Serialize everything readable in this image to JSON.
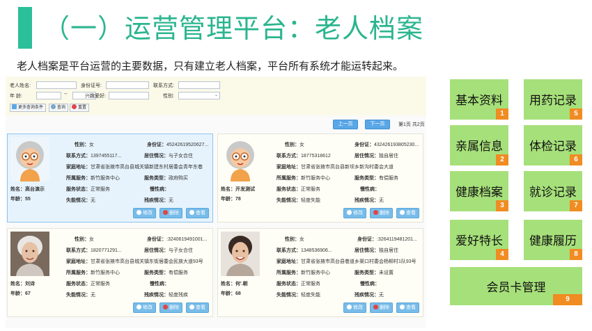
{
  "header": {
    "title": "（一）运营管理平台：老人档案",
    "subtitle": "老人档案是平台运营的主要数据，只有建立老人档案，平台所有系统才能运转起来。"
  },
  "search": {
    "name_label": "老人姓名:",
    "id_label": "身份证号:",
    "contact_label": "联系方式:",
    "age_label": "年 龄:",
    "age_dash": "--",
    "hobby_label": "兴趣爱好:",
    "gender_label": "性别:",
    "more_button": "更多查询条件",
    "query_button": "查询",
    "reset_button": "重置"
  },
  "pager": {
    "prev": "上一页",
    "next": "下一页",
    "info": "第1页 共2页"
  },
  "card_labels": {
    "gender": "性别：",
    "id": "身份证：",
    "contact": "联系方式：",
    "living": "居住情况：",
    "address": "家庭地址：",
    "agency": "所属服务：",
    "service_type": "服务类型：",
    "status": "服务状态：",
    "chronic": "慢性病：",
    "disability": "失能情况：",
    "handicap": "残疾情况：",
    "name": "姓名：",
    "age": "年龄："
  },
  "card_buttons": {
    "edit": "修改",
    "delete": "删除",
    "view": "查看"
  },
  "cards": [
    {
      "name": "高台演示",
      "age": "55",
      "gender": "女",
      "id": "45242619520627...",
      "contact": "1397455117...",
      "living": "与子女合住",
      "address": "甘肃省张掖市高台县城关镇新建东村居委会青年东巷",
      "agency": "新竹服务中心",
      "service_type": "政府购买",
      "status": "正常服务",
      "chronic": "",
      "disability": "无",
      "handicap": "无"
    },
    {
      "name": "开发测试",
      "age": "78",
      "gender": "女",
      "id": "432426193805230...",
      "contact": "18775318612",
      "living": "独自居住",
      "address": "甘肃省张掖市高台县新坝乡新沟村委会大道",
      "agency": "新竹服务中心",
      "service_type": "有偿服务",
      "status": "正常服务",
      "chronic": "",
      "disability": "轻度失能",
      "handicap": "无"
    },
    {
      "name": "刘诗",
      "age": "67",
      "gender": "女",
      "id": ":3240619491001...",
      "contact": "1820771291...",
      "living": "与子女合住",
      "address": "甘肃省张掖市高台县城关镇东街居委会民族大道93号",
      "agency": "新竹服务中心",
      "service_type": "有偿服务",
      "status": "正常服务",
      "chronic": "",
      "disability": "无",
      "handicap": "轻度残疾"
    },
    {
      "name": "何'.朝",
      "age": "68",
      "gender": "女",
      "id": ":3264119481201...",
      "contact": "1348536906...",
      "living": "独自居住",
      "address": "甘肃省张掖市高台县巷道乡渠口村委会杨柳村1队93号",
      "agency": "新竹服务中心",
      "service_type": "未设置",
      "status": "正常服务",
      "chronic": "",
      "disability": "轻度失能",
      "handicap": "无"
    }
  ],
  "tiles": [
    {
      "label": "基本资料",
      "num": "1"
    },
    {
      "label": "用药记录",
      "num": "5"
    },
    {
      "label": "亲属信息",
      "num": "2"
    },
    {
      "label": "体检记录",
      "num": "6"
    },
    {
      "label": "健康档案",
      "num": "3"
    },
    {
      "label": "就诊记录",
      "num": "7"
    },
    {
      "label": "爱好特长",
      "num": "4"
    },
    {
      "label": "健康履历",
      "num": "8"
    },
    {
      "label": "会员卡管理",
      "num": "9"
    }
  ],
  "colors": {
    "accent": "#2bb58f",
    "tile": "#a6e07a",
    "tile_badge": "#f08c22",
    "button": "#5aa7e8"
  }
}
